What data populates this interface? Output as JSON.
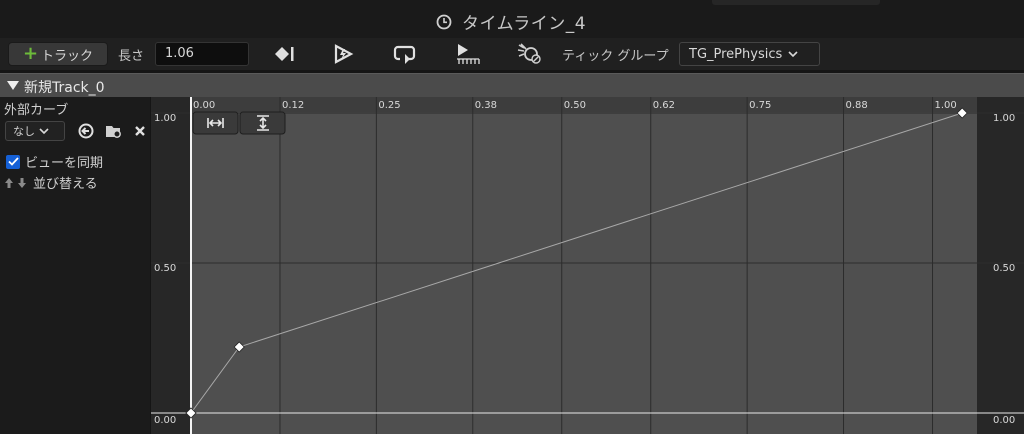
{
  "window": {
    "title": "タイムライン_4",
    "title_icon": "clock-icon"
  },
  "toolbar": {
    "add_track_label": "トラック",
    "length_label": "長さ",
    "length_value": "1.06",
    "icons": [
      "keyframe-end-icon",
      "autoplay-icon",
      "loop-icon",
      "last-keyframe-icon",
      "replicated-icon"
    ],
    "tick_group_label": "ティック グループ",
    "tick_group_value": "TG_PrePhysics"
  },
  "track": {
    "name": "新規Track_0"
  },
  "left_panel": {
    "external_curve_label": "外部カーブ",
    "curve_select_value": "なし",
    "sync_view_label": "ビューを同期",
    "sync_view_checked": true,
    "sort_label": "並び替える"
  },
  "colors": {
    "accent_blue": "#1560d6",
    "add_green": "#6dbb3a",
    "graph_bg": "#4f4f4f",
    "curve": "#a8a8a8"
  },
  "chart_data": {
    "type": "line",
    "x_ticks": [
      "0.00",
      "0.12",
      "0.25",
      "0.38",
      "0.50",
      "0.62",
      "0.75",
      "0.88",
      "1.00"
    ],
    "y_ticks": [
      "0.00",
      "0.50",
      "1.00"
    ],
    "xlim": [
      0,
      1.06
    ],
    "ylim": [
      0,
      1
    ],
    "grid": true,
    "series": [
      {
        "x": [
          0.0,
          0.065,
          1.04
        ],
        "y": [
          0.0,
          0.22,
          1.0
        ]
      }
    ]
  }
}
